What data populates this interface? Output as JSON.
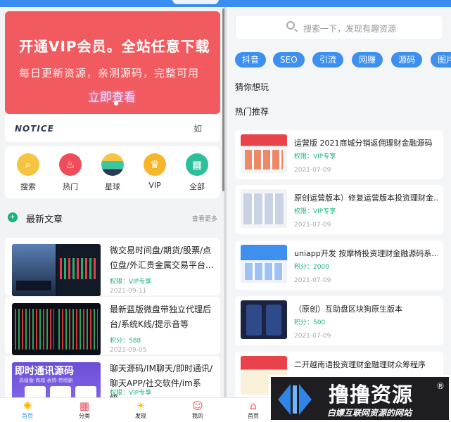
{
  "banner": {
    "line1": "开通VIP会员。全站任意下载",
    "line2": "每日更新资源，亲测源码，完整可用",
    "cta": "立即查看"
  },
  "notice": {
    "logo": "NOTICE",
    "text": "如"
  },
  "categories": [
    {
      "label": "搜索",
      "icon": "search-icon",
      "color": "#f5c542",
      "glyph": "⌕"
    },
    {
      "label": "热门",
      "icon": "fire-icon",
      "color": "#ee4d5a",
      "glyph": "♨"
    },
    {
      "label": "星球",
      "icon": "planet-icon",
      "color": "#3cc9a0",
      "glyph": "◉"
    },
    {
      "label": "VIP",
      "icon": "crown-icon",
      "color": "#f6b629",
      "glyph": "♛"
    },
    {
      "label": "全部",
      "icon": "grid-icon",
      "color": "#2cbf9a",
      "glyph": "▦"
    }
  ],
  "section": {
    "title": "最新文章",
    "more": "查看更多"
  },
  "articles": [
    {
      "title": "微交易时间盘/期货/股票/点位盘/外汇贵金属交易平台...",
      "meta": "权限：VIP专享",
      "date": "2021-09-11"
    },
    {
      "title": "最新蓝版微盘带独立代理后台/系统K线/提示音等",
      "meta": "积分：588",
      "date": "2021-09-05"
    },
    {
      "title": "聊天源码/IM聊天/即时通讯/聊天APP/社交软件/im系统...",
      "meta": "权限：VIP专享",
      "date": "2021-09-05",
      "thumb_text": "即时通讯源码",
      "thumb_sub": "高级版·商城·表情·带增删"
    }
  ],
  "tabbar": [
    {
      "label": "首页",
      "icon": "home-icon",
      "glyph": "✺",
      "active": true
    },
    {
      "label": "分类",
      "icon": "category-icon",
      "glyph": "▦"
    },
    {
      "label": "发现",
      "icon": "bulb-icon",
      "glyph": "☀"
    },
    {
      "label": "我的",
      "icon": "user-icon",
      "glyph": "☺"
    },
    {
      "label": "首页",
      "icon": "home-icon",
      "glyph": "⌂"
    }
  ],
  "search": {
    "placeholder": "搜索一下，发现有趣资源"
  },
  "tags": [
    "抖音",
    "SEO",
    "引流",
    "网赚",
    "源码",
    "图片"
  ],
  "guess_label": "猜你想玩",
  "hot_label": "热门推荐",
  "recommend": [
    {
      "title": "运营版 2021商城分销返佣理财金融源码",
      "meta": "权限：VIP专享",
      "date": "2021-07-09"
    },
    {
      "title": "原创运营版本）修复运营版本投资理财金...",
      "meta": "权限：VIP专享",
      "date": "2021-07-09"
    },
    {
      "title": "uniapp开发 按摩椅投资理财金融源码系...",
      "meta": "积分：2000",
      "date": "2021-07-09"
    },
    {
      "title": "（原创）互助盘区块狗原生版本",
      "meta": "积分：500",
      "date": "2021-07-09"
    },
    {
      "title": "二开越南语投资理财金融理财众筹程序",
      "meta": "",
      "date": ""
    }
  ],
  "watermark": {
    "name": "撸撸资源",
    "slogan": "白嫖互联网资源的网站",
    "reg": "®"
  },
  "colors": {
    "accent": "#3d8ff0",
    "banner": "#f15b5f",
    "green": "#19b37a"
  }
}
